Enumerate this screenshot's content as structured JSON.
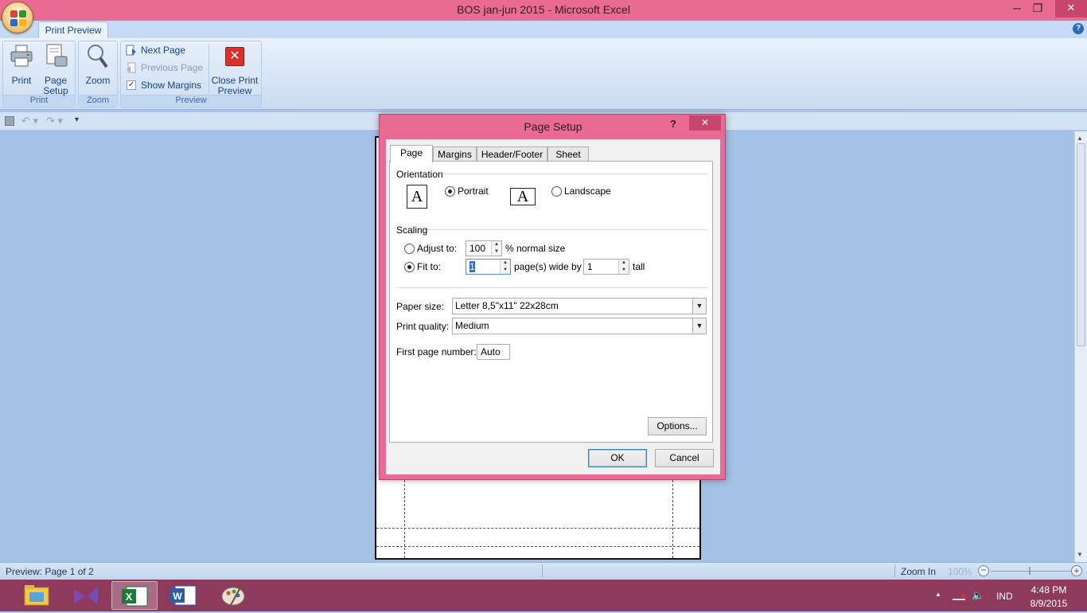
{
  "window": {
    "title": "BOS jan-jun 2015 - Microsoft Excel",
    "minimize": "─",
    "restore": "❐",
    "close": "✕",
    "help": "?"
  },
  "ribbon": {
    "tab": "Print Preview",
    "groups": {
      "print": {
        "label": "Print",
        "print_btn": "Print",
        "page_setup_line1": "Page",
        "page_setup_line2": "Setup"
      },
      "zoom": {
        "label": "Zoom",
        "zoom_btn": "Zoom"
      },
      "preview": {
        "label": "Preview",
        "next_page": "Next Page",
        "previous_page": "Previous Page",
        "show_margins": "Show Margins",
        "close_line1": "Close Print",
        "close_line2": "Preview"
      }
    }
  },
  "dialog": {
    "title": "Page Setup",
    "help": "?",
    "close": "✕",
    "tabs": [
      "Page",
      "Margins",
      "Header/Footer",
      "Sheet"
    ],
    "orientation": {
      "heading": "Orientation",
      "portrait": "Portrait",
      "landscape": "Landscape",
      "icon_glyph": "A",
      "selected": "portrait"
    },
    "scaling": {
      "heading": "Scaling",
      "adjust_to": "Adjust to:",
      "adjust_value": "100",
      "normal_size": "% normal size",
      "fit_to": "Fit to:",
      "fit_wide_value": "1",
      "pages_wide_by": "page(s) wide by",
      "fit_tall_value": "1",
      "tall": "tall",
      "selected": "fit_to"
    },
    "paper_size": {
      "label": "Paper size:",
      "value": "Letter 8,5\"x11\" 22x28cm"
    },
    "print_quality": {
      "label": "Print quality:",
      "value": "Medium"
    },
    "first_page": {
      "label": "First page number:",
      "value": "Auto"
    },
    "options_btn": "Options...",
    "ok": "OK",
    "cancel": "Cancel"
  },
  "status": {
    "preview": "Preview: Page 1 of 2",
    "zoom_in": "Zoom In",
    "zoom_level": "100%"
  },
  "taskbar": {
    "lang": "IND",
    "time": "4:48 PM",
    "date": "8/9/2015"
  },
  "colors": {
    "title_bar": "#e96a92",
    "taskbar": "#8e3a5c",
    "workspace": "#a3c0e5"
  }
}
